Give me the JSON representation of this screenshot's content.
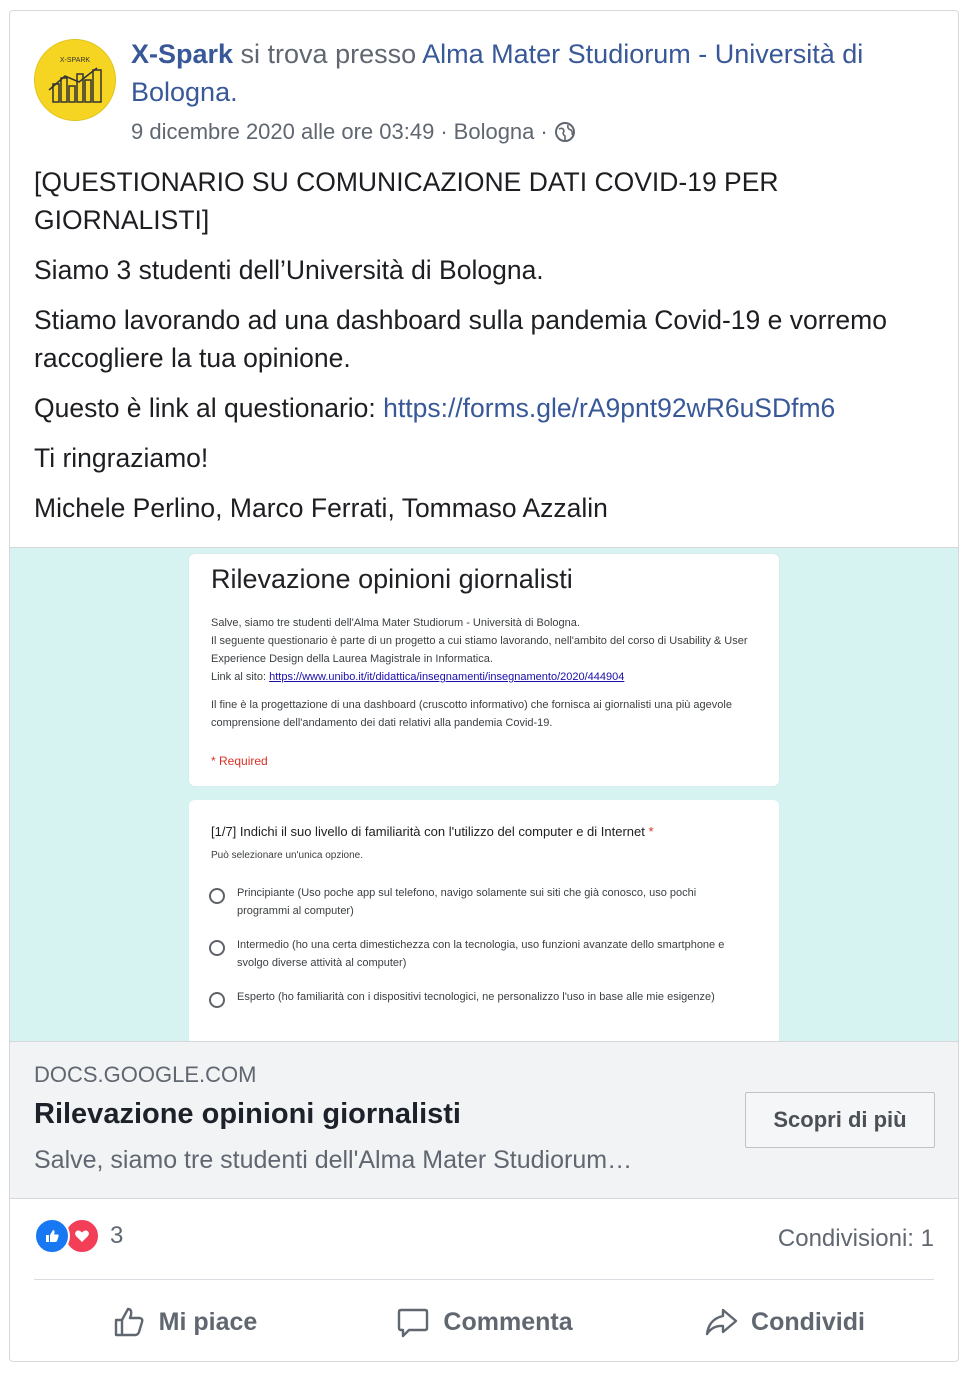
{
  "post": {
    "author": "X-Spark",
    "location_text": " si trova presso ",
    "location_link": "Alma Mater Studiorum - Università di Bologna.",
    "date": "9 dicembre 2020 alle ore 03:49",
    "sep": "·",
    "place": "Bologna",
    "sep2": "·",
    "avatar_icon": "x-spark-logo-icon",
    "avatar_text": "X-SPARK",
    "paragraphs": [
      "[QUESTIONARIO SU COMUNICAZIONE DATI COVID-19 PER GIORNALISTI]",
      "Siamo 3 studenti dell’Università di Bologna.",
      "Stiamo lavorando ad una dashboard sulla pandemia Covid-19 e vorremo raccogliere la tua opinione."
    ],
    "link_prefix": "Questo è link al questionario: ",
    "link_url": "https://forms.gle/rA9pnt92wR6uSDfm6",
    "thanks": "Ti ringraziamo!",
    "signature": "Michele Perlino, Marco Ferrati, Tommaso Azzalin"
  },
  "preview": {
    "form_title": "Rilevazione opinioni giornalisti",
    "desc_line1": "Salve, siamo tre studenti dell'Alma Mater Studiorum - Università di Bologna.",
    "desc_line2": "Il seguente questionario è parte di un progetto a cui stiamo lavorando, nell'ambito del corso di Usability & User Experience Design della Laurea Magistrale in Informatica.",
    "desc_link_label": "Link al sito: ",
    "desc_link": "https://www.unibo.it/it/didattica/insegnamenti/insegnamento/2020/444904",
    "desc_line3": "Il fine è la progettazione di una dashboard (cruscotto informativo) che fornisca ai giornalisti una più agevole comprensione dell'andamento dei dati relativi alla pandemia Covid-19.",
    "required": "* Required",
    "question": "[1/7] Indichi il suo livello di familiarità con l'utilizzo del computer e di Internet",
    "question_star": "*",
    "hint": "Può selezionare un'unica opzione.",
    "options": [
      "Principiante (Uso poche app sul telefono, navigo solamente sui siti che già conosco, uso pochi programmi al computer)",
      "Intermedio (ho una certa dimestichezza con la tecnologia, uso funzioni avanzate dello smartphone e svolgo diverse attività al computer)",
      "Esperto (ho familiarità con i dispositivi tecnologici, ne personalizzo l'uso in base alle mie esigenze)"
    ]
  },
  "link_card": {
    "domain": "DOCS.GOOGLE.COM",
    "title": "Rilevazione opinioni giornalisti",
    "subtitle": "Salve, siamo tre studenti dell'Alma Mater Studiorum…",
    "button": "Scopri di più"
  },
  "stats": {
    "reaction_count": "3",
    "shares": "Condivisioni: 1",
    "reaction_icons": [
      "like-reaction-icon",
      "love-reaction-icon"
    ]
  },
  "actions": {
    "like": "Mi piace",
    "comment": "Commenta",
    "share": "Condividi"
  },
  "colors": {
    "link_blue": "#385898",
    "preview_bg": "#d7f3f1",
    "like_blue": "#1877f2",
    "love_red": "#f33e58",
    "avatar_yellow": "#f5d422"
  }
}
